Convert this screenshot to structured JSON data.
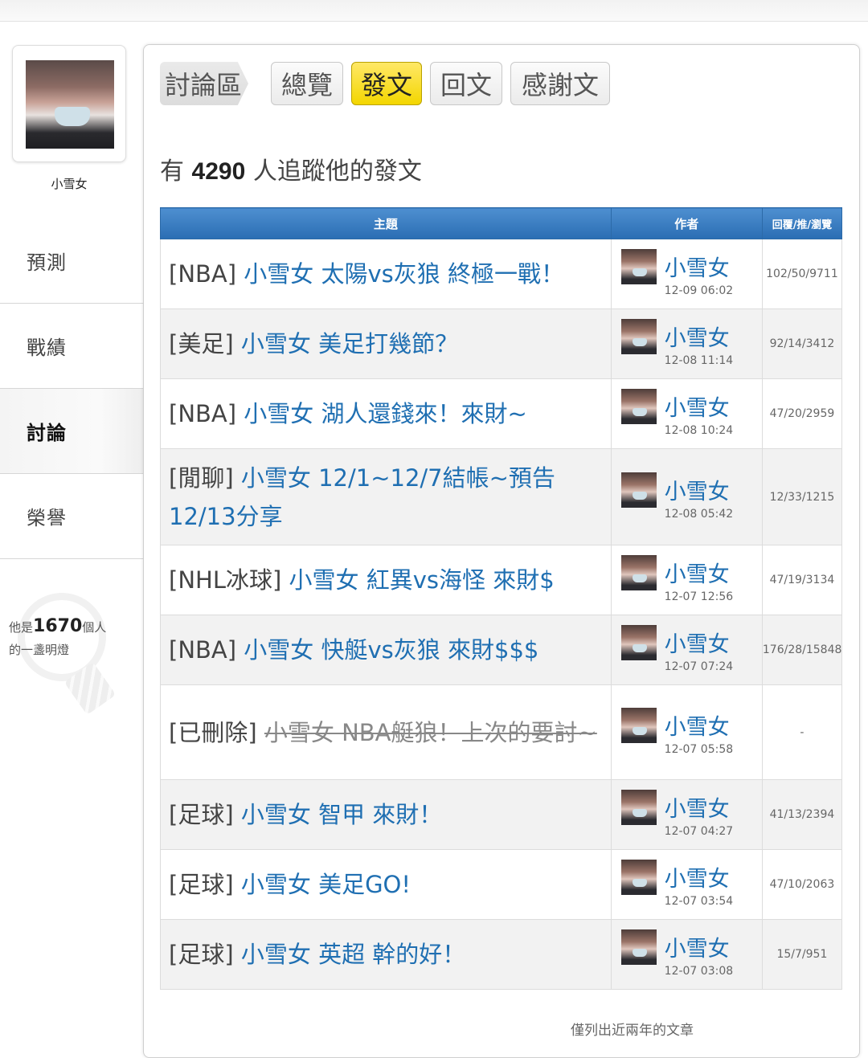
{
  "profile": {
    "name": "小雪女",
    "followers_prefix": "有",
    "followers_count": "4290",
    "followers_suffix": "人追蹤他的發文",
    "light_prefix": "他是",
    "light_count": "1670",
    "light_suffix1": "個人",
    "light_suffix2": "的一盞明燈"
  },
  "side_nav": [
    "預測",
    "戰績",
    "討論",
    "榮譽"
  ],
  "side_nav_active": "討論",
  "tabs": {
    "crumb": "討論區",
    "items": [
      "總覽",
      "發文",
      "回文",
      "感謝文"
    ],
    "active": "發文"
  },
  "table": {
    "headers": [
      "主題",
      "作者",
      "回覆/推/瀏覽"
    ],
    "rows": [
      {
        "category": "[NBA]",
        "title": "小雪女 太陽vs灰狼 終極一戰！",
        "author": "小雪女",
        "time": "12-09 06:02",
        "stats": "102/50/9711",
        "deleted": false
      },
      {
        "category": "[美足]",
        "title": "小雪女 美足打幾節？",
        "author": "小雪女",
        "time": "12-08 11:14",
        "stats": "92/14/3412",
        "deleted": false
      },
      {
        "category": "[NBA]",
        "title": "小雪女 湖人還錢來！來財~",
        "author": "小雪女",
        "time": "12-08 10:24",
        "stats": "47/20/2959",
        "deleted": false
      },
      {
        "category": "[閒聊]",
        "title": "小雪女 12/1~12/7結帳~預告12/13分享",
        "author": "小雪女",
        "time": "12-08 05:42",
        "stats": "12/33/1215",
        "deleted": false
      },
      {
        "category": "[NHL冰球]",
        "title": "小雪女 紅異vs海怪 來財$",
        "author": "小雪女",
        "time": "12-07 12:56",
        "stats": "47/19/3134",
        "deleted": false
      },
      {
        "category": "[NBA]",
        "title": "小雪女 快艇vs灰狼 來財$$$",
        "author": "小雪女",
        "time": "12-07 07:24",
        "stats": "176/28/15848",
        "deleted": false
      },
      {
        "category": "[已刪除]",
        "title": "小雪女 NBA艇狼！上次的要討~",
        "author": "小雪女",
        "time": "12-07 05:58",
        "stats": "-",
        "deleted": true
      },
      {
        "category": "[足球]",
        "title": "小雪女 智甲 來財！",
        "author": "小雪女",
        "time": "12-07 04:27",
        "stats": "41/13/2394",
        "deleted": false
      },
      {
        "category": "[足球]",
        "title": "小雪女 美足GO!",
        "author": "小雪女",
        "time": "12-07 03:54",
        "stats": "47/10/2063",
        "deleted": false
      },
      {
        "category": "[足球]",
        "title": "小雪女 英超 幹的好！",
        "author": "小雪女",
        "time": "12-07 03:08",
        "stats": "15/7/951",
        "deleted": false
      }
    ]
  },
  "footer_note": "僅列出近兩年的文章",
  "colors": {
    "link": "#1f6fb2",
    "header_bg": "#2a6db3",
    "active_tab": "#f3d600"
  }
}
